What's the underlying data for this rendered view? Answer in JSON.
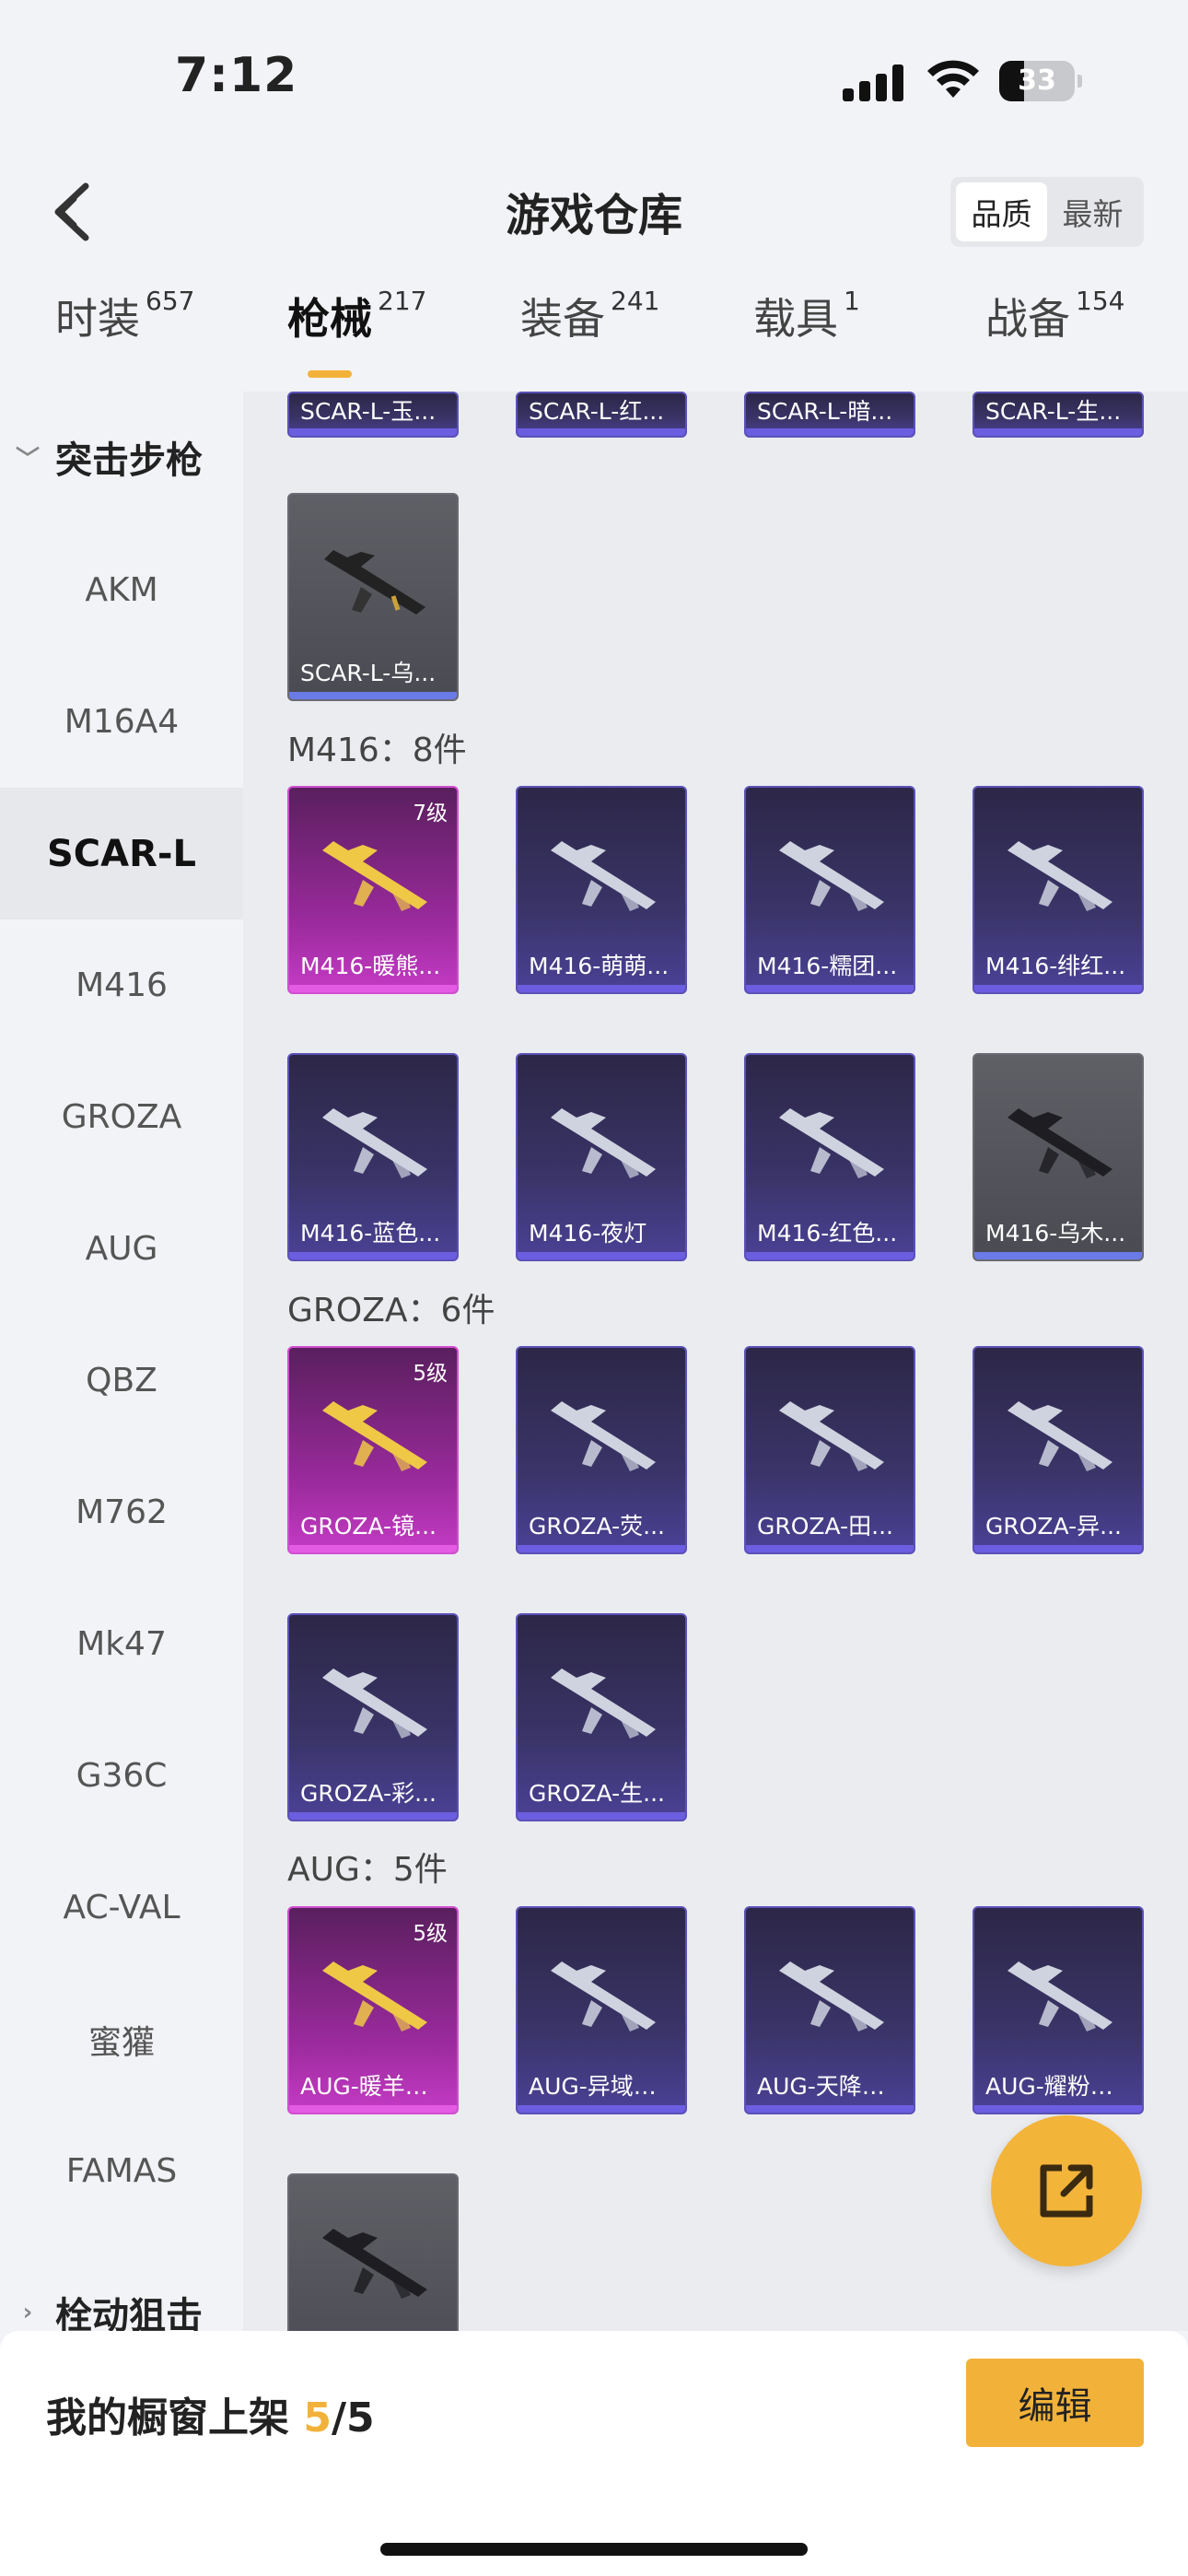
{
  "status_bar": {
    "time": "7:12",
    "battery": "33",
    "battery_level": 0.33
  },
  "header": {
    "title": "游戏仓库",
    "back_icon": "chevron-left-icon",
    "sort_options": [
      "品质",
      "最新"
    ],
    "sort_active": "品质"
  },
  "tabs": [
    {
      "label": "时装",
      "count": "657"
    },
    {
      "label": "枪械",
      "count": "217",
      "active": true
    },
    {
      "label": "装备",
      "count": "241"
    },
    {
      "label": "载具",
      "count": "1"
    },
    {
      "label": "战备",
      "count": "154"
    }
  ],
  "sidebar": {
    "group_open": "突击步枪",
    "items": [
      "AKM",
      "M16A4",
      "SCAR-L",
      "M416",
      "GROZA",
      "AUG",
      "QBZ",
      "M762",
      "Mk47",
      "G36C",
      "AC-VAL",
      "蜜獾",
      "FAMAS"
    ],
    "active": "SCAR-L",
    "group_next": "栓动狙击"
  },
  "content": {
    "scar_top_row": [
      "SCAR-L-玉...",
      "SCAR-L-红...",
      "SCAR-L-暗...",
      "SCAR-L-生..."
    ],
    "scar_extra": "SCAR-L-乌...",
    "m416_title": "M416：8件",
    "m416": [
      {
        "name": "M416-暖熊...",
        "level": "7级",
        "rarity": "pink"
      },
      {
        "name": "M416-萌萌...",
        "rarity": "purple"
      },
      {
        "name": "M416-糯团...",
        "rarity": "purple"
      },
      {
        "name": "M416-绯红...",
        "rarity": "purple"
      },
      {
        "name": "M416-蓝色...",
        "rarity": "purple"
      },
      {
        "name": "M416-夜灯",
        "rarity": "purple"
      },
      {
        "name": "M416-红色...",
        "rarity": "purple"
      },
      {
        "name": "M416-乌木...",
        "rarity": "grey"
      }
    ],
    "groza_title": "GROZA：6件",
    "groza": [
      {
        "name": "GROZA-镜...",
        "level": "5级",
        "rarity": "pink"
      },
      {
        "name": "GROZA-荧...",
        "rarity": "purple"
      },
      {
        "name": "GROZA-田...",
        "rarity": "purple"
      },
      {
        "name": "GROZA-异...",
        "rarity": "purple"
      },
      {
        "name": "GROZA-彩...",
        "rarity": "purple"
      },
      {
        "name": "GROZA-生...",
        "rarity": "purple"
      }
    ],
    "aug_title": "AUG：5件",
    "aug": [
      {
        "name": "AUG-暖羊咩咩",
        "level": "5级",
        "rarity": "pink"
      },
      {
        "name": "AUG-异域银装",
        "rarity": "purple"
      },
      {
        "name": "AUG-天降萌叽",
        "rarity": "purple"
      },
      {
        "name": "AUG-耀粉歌者",
        "rarity": "purple"
      },
      {
        "name": "",
        "rarity": "grey"
      }
    ]
  },
  "fab": {
    "icon": "share-icon"
  },
  "bottom": {
    "label_prefix": "我的橱窗上架 ",
    "current": "5",
    "total": "/5",
    "edit": "编辑"
  }
}
